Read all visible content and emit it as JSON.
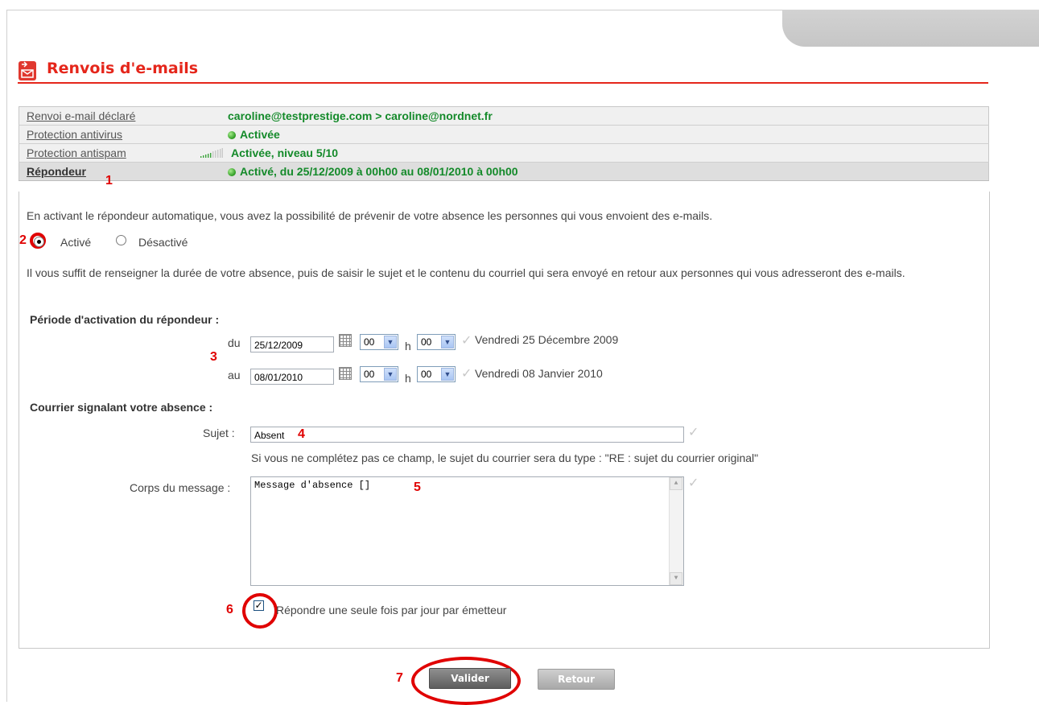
{
  "header": {
    "title": "Renvois d'e-mails"
  },
  "summary": {
    "rows": [
      {
        "label": "Renvoi e-mail déclaré",
        "value": "caroline@testprestige.com > caroline@nordnet.fr"
      },
      {
        "label": "Protection antivirus",
        "value": "Activée",
        "icon": "status-green-dot-icon"
      },
      {
        "label": "Protection antispam",
        "value": "Activée, niveau 5/10",
        "icon": "signal-level-icon",
        "level": 5,
        "level_max": 10
      },
      {
        "label": "Répondeur",
        "value": "Activé, du 25/12/2009 à 00h00 au 08/01/2010 à 00h00",
        "icon": "status-green-dot-icon"
      }
    ]
  },
  "annotations": {
    "n1": "1",
    "n2": "2",
    "n3": "3",
    "n4": "4",
    "n5": "5",
    "n6": "6",
    "n7": "7"
  },
  "intro": "En activant le répondeur automatique, vous avez la possibilité de prévenir de votre absence les personnes qui vous envoient des e-mails.",
  "radio": {
    "on_label": "Activé",
    "off_label": "Désactivé",
    "selected": "Activé"
  },
  "instructions": "Il vous suffit de renseigner la durée de votre absence, puis de saisir le sujet et le contenu du courriel qui sera envoyé en retour aux personnes qui vous adresseront des e-mails.",
  "period": {
    "heading": "Période d'activation du répondeur :",
    "from_label": "du",
    "to_label": "au",
    "hour_sep": "h",
    "from": {
      "date": "25/12/2009",
      "hour": "00",
      "minute": "00",
      "readable": "Vendredi 25 Décembre 2009"
    },
    "to": {
      "date": "08/01/2010",
      "hour": "00",
      "minute": "00",
      "readable": "Vendredi 08 Janvier 2010"
    }
  },
  "mail": {
    "heading": "Courrier signalant votre absence :",
    "subject_label": "Sujet :",
    "subject_value": "Absent",
    "subject_hint": "Si vous ne complétez pas ce champ, le sujet du courrier sera du type : \"RE : sujet du courrier original\"",
    "body_label": "Corps du message :",
    "body_value": "Message d'absence []",
    "once_label": "Répondre une seule fois par jour par émetteur",
    "once_checked": true
  },
  "buttons": {
    "submit": "Valider",
    "back": "Retour"
  },
  "colors": {
    "accent": "#e5261b",
    "success": "#148a2a",
    "annotation": "#e00000"
  }
}
